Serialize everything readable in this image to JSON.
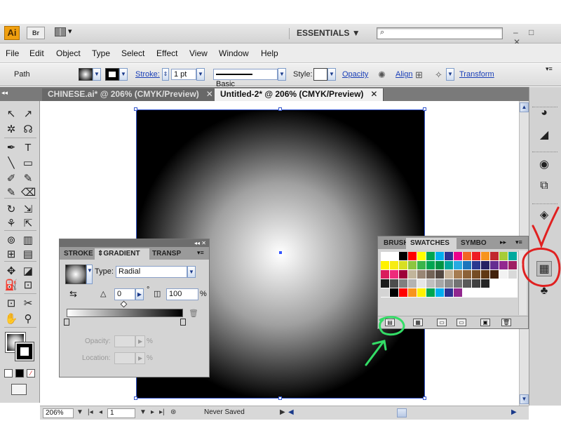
{
  "app": {
    "logo": "Ai",
    "bridge_label": "Br",
    "workspace": "ESSENTIALS",
    "workspace_arrow": "▼",
    "search_icon": "⌕",
    "window_controls": "– □ ✕"
  },
  "menu": [
    "File",
    "Edit",
    "Object",
    "Type",
    "Select",
    "Effect",
    "View",
    "Window",
    "Help"
  ],
  "control_bar": {
    "selection": "Path",
    "stroke_label": "Stroke:",
    "stroke_value": "1 pt",
    "brush_label": "Basic",
    "style_label": "Style:",
    "opacity_label": "Opacity",
    "align_label": "Align",
    "transform_label": "Transform"
  },
  "tabs": [
    {
      "label": "CHINESE.ai* @ 206% (CMYK/Preview)",
      "active": false
    },
    {
      "label": "Untitled-2* @ 206% (CMYK/Preview)",
      "active": true
    }
  ],
  "status": {
    "zoom": "206%",
    "page": "1",
    "saved": "Never Saved"
  },
  "gradient_panel": {
    "tabs": [
      "STROKE",
      "GRADIENT",
      "TRANSP"
    ],
    "type_label": "Type:",
    "type_value": "Radial",
    "angle_value": "0",
    "degree": "°",
    "aspect_value": "100",
    "percent": "%",
    "opacity_label": "Opacity:",
    "location_label": "Location:",
    "stop_colors": [
      "#ffffff",
      "#000000"
    ]
  },
  "swatches_panel": {
    "tabs": [
      "BRUSH",
      "SWATCHES",
      "SYMBO"
    ],
    "rows": [
      [
        "#ffffff",
        "#ffffff",
        "#000000",
        "#ff0000",
        "#ffff00",
        "#00a650",
        "#00aeef",
        "#2e3192",
        "#ec008c",
        "#f26522",
        "#ed1c24",
        "#f7941d",
        "#c1272d",
        "#a6cc38",
        "#00a99d"
      ],
      [
        "#fff200",
        "#f7ec13",
        "#d7df23",
        "#8dc63f",
        "#39b54a",
        "#00a651",
        "#009444",
        "#00a79d",
        "#27aae1",
        "#1c75bc",
        "#2b3990",
        "#262262",
        "#662d91",
        "#92278f",
        "#9e1f63"
      ],
      [
        "#da1c5c",
        "#ee2a7b",
        "#9e0039",
        "#c2b59b",
        "#998675",
        "#736357",
        "#534741",
        "#c7b299",
        "#a67c52",
        "#8c6239",
        "#754c24",
        "#603813",
        "#42210b",
        "#f2f2f2",
        "#d9d9d9"
      ],
      [
        "#1a1a1a",
        "#4d4d4d",
        "#808080",
        "#b3b3b3",
        "#e6e6e6",
        "#bfbfbf",
        "#a6a6a6",
        "#8c8c8c",
        "#737373",
        "#595959",
        "#404040",
        "#262626",
        "#ffffff",
        "#ffffff",
        "#ffffff"
      ],
      [
        "#d4d4d4",
        "#000000",
        "#ff0000",
        "#f7941d",
        "#fff200",
        "#00a651",
        "#00aeef",
        "#2e3192",
        "#92278f",
        "#ffffff",
        "#ffffff",
        "#ffffff",
        "#ffffff",
        "#ffffff",
        "#ffffff"
      ]
    ]
  },
  "icons": {
    "tools": [
      [
        "selection-icon",
        "direct-selection-icon"
      ],
      [
        "magic-wand-icon",
        "lasso-icon"
      ],
      [
        "pen-icon",
        "type-icon"
      ],
      [
        "line-icon",
        "rectangle-icon"
      ],
      [
        "paintbrush-icon",
        "pencil-icon"
      ],
      [
        "blob-brush-icon",
        "eraser-icon"
      ],
      [
        "rotate-icon",
        "scale-icon"
      ],
      [
        "warp-icon",
        "free-transform-icon"
      ],
      [
        "symbol-sprayer-icon",
        "column-graph-icon"
      ],
      [
        "mesh-icon",
        "gradient-icon"
      ],
      [
        "eyedropper-icon",
        "blend-icon"
      ],
      [
        "live-paint-bucket-icon",
        "live-paint-selection-icon"
      ],
      [
        "artboard-icon",
        "slice-icon"
      ],
      [
        "hand-icon",
        "zoom-icon"
      ]
    ],
    "tool_glyphs": [
      [
        "↖",
        "↗"
      ],
      [
        "✲",
        "☊"
      ],
      [
        "✒",
        "T"
      ],
      [
        "╲",
        "▭"
      ],
      [
        "✐",
        "✎"
      ],
      [
        "✎",
        "⌫"
      ],
      [
        "↻",
        "⇲"
      ],
      [
        "⚘",
        "⇱"
      ],
      [
        "⊚",
        "▥"
      ],
      [
        "⊞",
        "▤"
      ],
      [
        "✥",
        "◪"
      ],
      [
        "⛽",
        "⊡"
      ],
      [
        "⊡",
        "✂"
      ],
      [
        "✋",
        "⚲"
      ]
    ],
    "dock": [
      [
        "color-icon",
        "◕"
      ],
      [
        "color-guide-icon",
        "◢"
      ],
      [
        "appearance-icon",
        "◉"
      ],
      [
        "graphic-styles-icon",
        "⧉"
      ],
      [
        "layers-icon",
        "◈"
      ],
      [
        "swatches-icon",
        "▦"
      ],
      [
        "symbols-icon",
        "♣"
      ]
    ]
  },
  "annotation_colors": {
    "red": "#e02020",
    "green": "#33dd66"
  }
}
